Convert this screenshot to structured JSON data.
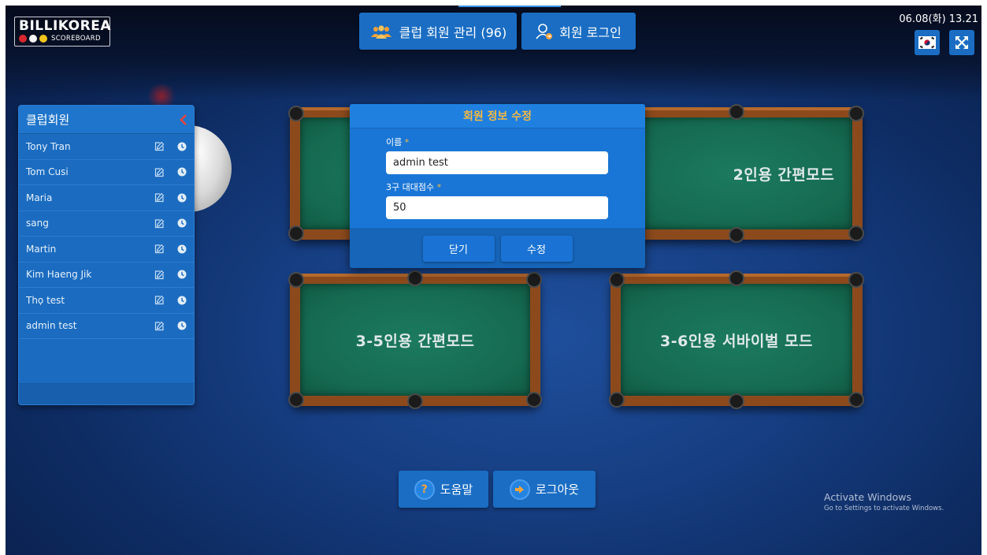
{
  "app": {
    "logo_title": "BILLIKOREA",
    "logo_subtitle": "SCOREBOARD"
  },
  "header": {
    "club_members_label": "클럽 회원 관리 (96)",
    "member_login_label": "회원 로그인",
    "datetime": "06.08(화) 13.21",
    "lang_icon": "korea-flag-icon",
    "fullscreen_icon": "fullscreen-icon"
  },
  "sidebar": {
    "title": "클럽회원",
    "members": [
      {
        "name": "Tony Tran"
      },
      {
        "name": "Tom Cusi"
      },
      {
        "name": "Maria"
      },
      {
        "name": "sang"
      },
      {
        "name": "Martin"
      },
      {
        "name": "Kim Haeng Jik"
      },
      {
        "name": "Thọ test"
      },
      {
        "name": "admin test"
      }
    ]
  },
  "tables": {
    "t2": "2인용 간편모드",
    "t3": "3-5인용 간편모드",
    "t4": "3-6인용 서바이벌 모드"
  },
  "modal": {
    "title": "회원 정보 수정",
    "name_label": "이름",
    "name_value": "admin test",
    "score_label": "3구 대대점수",
    "score_value": "50",
    "required_mark": "*",
    "close_label": "닫기",
    "edit_label": "수정"
  },
  "footer": {
    "help_label": "도움말",
    "logout_label": "로그아웃"
  },
  "watermark": {
    "line1": "Activate Windows",
    "line2": "Go to Settings to activate Windows."
  },
  "colors": {
    "accent": "#1a6dc3",
    "modal_title": "#f5b942",
    "felt": "#156a50",
    "rail": "#8c4a1c"
  }
}
